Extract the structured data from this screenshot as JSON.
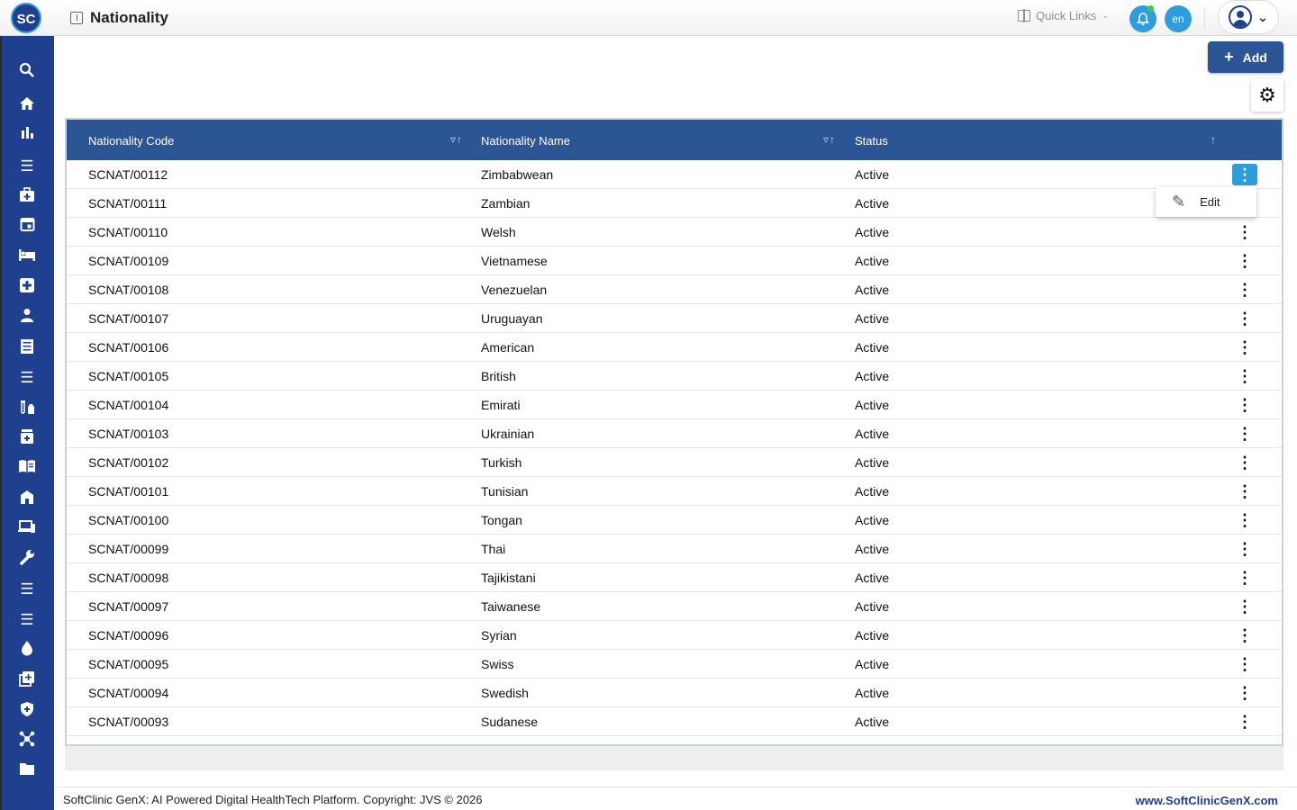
{
  "app": {
    "logo_text": "SC",
    "page_title": "Nationality"
  },
  "header": {
    "quick_links_label": "Quick Links",
    "language": "en"
  },
  "sidebar": {
    "icons": [
      "search-icon",
      "home-icon",
      "bar-chart-icon",
      "menu-icon",
      "medical-bag-icon",
      "calendar-icon",
      "bed-icon",
      "medical-plus-icon",
      "person-icon",
      "document-icon",
      "menu-icon",
      "lab-tubes-icon",
      "pharmacy-icon",
      "book-icon",
      "hospital-icon",
      "devices-icon",
      "wrench-icon",
      "menu-icon",
      "menu-icon",
      "drop-icon",
      "add-box-icon",
      "shield-icon",
      "network-icon",
      "folder-icon"
    ]
  },
  "actions": {
    "add_label": "Add",
    "edit_label": "Edit"
  },
  "table": {
    "columns": [
      "Nationality Code",
      "Nationality Name",
      "Status"
    ],
    "rows": [
      {
        "code": "SCNAT/00112",
        "name": "Zimbabwean",
        "status": "Active"
      },
      {
        "code": "SCNAT/00111",
        "name": "Zambian",
        "status": "Active"
      },
      {
        "code": "SCNAT/00110",
        "name": "Welsh",
        "status": "Active"
      },
      {
        "code": "SCNAT/00109",
        "name": "Vietnamese",
        "status": "Active"
      },
      {
        "code": "SCNAT/00108",
        "name": "Venezuelan",
        "status": "Active"
      },
      {
        "code": "SCNAT/00107",
        "name": "Uruguayan",
        "status": "Active"
      },
      {
        "code": "SCNAT/00106",
        "name": "American",
        "status": "Active"
      },
      {
        "code": "SCNAT/00105",
        "name": "British",
        "status": "Active"
      },
      {
        "code": "SCNAT/00104",
        "name": "Emirati",
        "status": "Active"
      },
      {
        "code": "SCNAT/00103",
        "name": "Ukrainian",
        "status": "Active"
      },
      {
        "code": "SCNAT/00102",
        "name": "Turkish",
        "status": "Active"
      },
      {
        "code": "SCNAT/00101",
        "name": "Tunisian",
        "status": "Active"
      },
      {
        "code": "SCNAT/00100",
        "name": "Tongan",
        "status": "Active"
      },
      {
        "code": "SCNAT/00099",
        "name": "Thai",
        "status": "Active"
      },
      {
        "code": "SCNAT/00098",
        "name": "Tajikistani",
        "status": "Active"
      },
      {
        "code": "SCNAT/00097",
        "name": "Taiwanese",
        "status": "Active"
      },
      {
        "code": "SCNAT/00096",
        "name": "Syrian",
        "status": "Active"
      },
      {
        "code": "SCNAT/00095",
        "name": "Swiss",
        "status": "Active"
      },
      {
        "code": "SCNAT/00094",
        "name": "Swedish",
        "status": "Active"
      },
      {
        "code": "SCNAT/00093",
        "name": "Sudanese",
        "status": "Active"
      }
    ]
  },
  "footer": {
    "copyright": "SoftClinic GenX: AI Powered Digital HealthTech Platform. Copyright: JVS © 2026",
    "website": "www.SoftClinicGenX.com"
  },
  "colors": {
    "brand_dark": "#1f3f8f",
    "header_blue": "#2c5596",
    "accent": "#2f9ddb"
  }
}
